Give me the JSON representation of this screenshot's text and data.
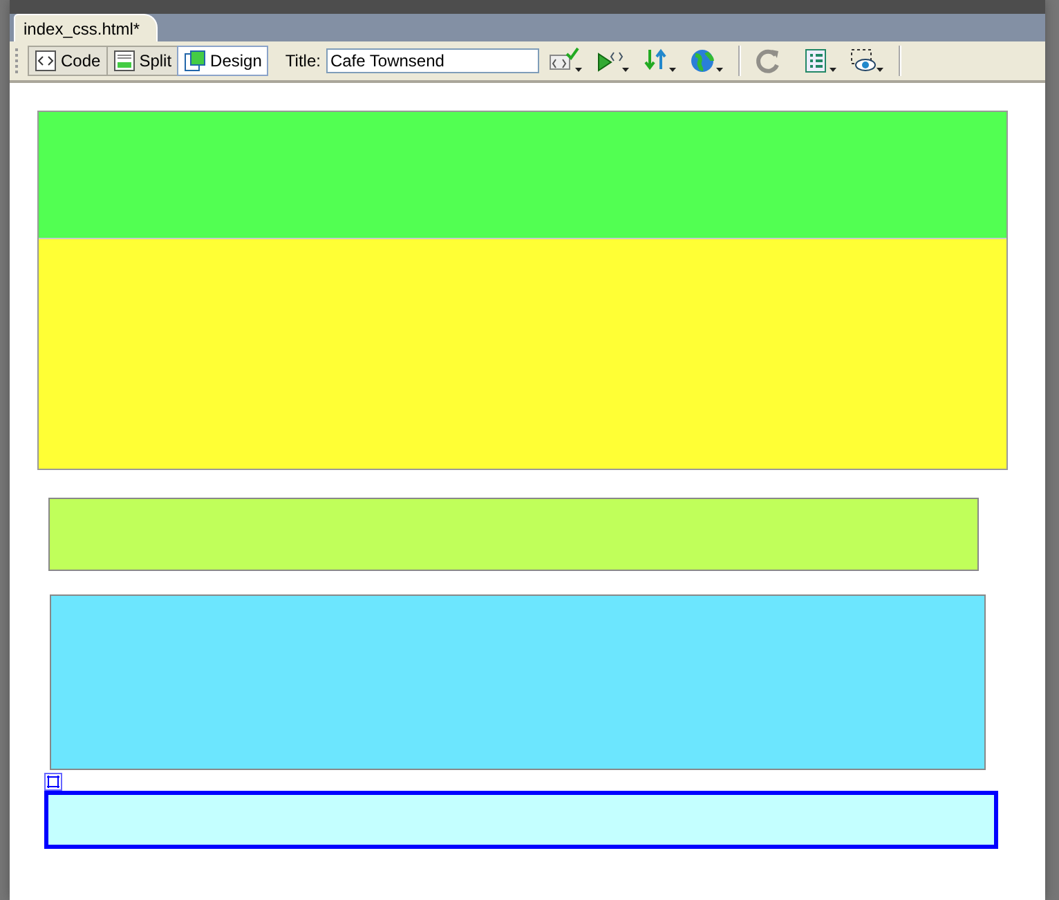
{
  "document_tab": {
    "label": "index_css.html*",
    "selected": true
  },
  "view_buttons": [
    {
      "kind": "code",
      "label": "Code",
      "selected": false
    },
    {
      "kind": "split",
      "label": "Split",
      "selected": false
    },
    {
      "kind": "design",
      "label": "Design",
      "selected": true
    }
  ],
  "title_field": {
    "label": "Title:",
    "value": "Cafe Townsend"
  },
  "toolbar_icons": [
    {
      "kind": "validate",
      "disabled": false
    },
    {
      "kind": "preview",
      "disabled": false
    },
    {
      "kind": "transfer",
      "disabled": false
    },
    {
      "kind": "globe",
      "disabled": false
    },
    {
      "kind": "refresh",
      "disabled": true
    },
    {
      "kind": "options",
      "disabled": false
    },
    {
      "kind": "visual-aids",
      "disabled": false
    }
  ],
  "blocks": [
    {
      "kind": "stack",
      "sections": [
        {
          "color": "#52ff52"
        },
        {
          "color": "#ffff35"
        }
      ]
    },
    {
      "kind": "box",
      "color": "#c0ff5a",
      "selected": false
    },
    {
      "kind": "box",
      "color": "#6ce6fe",
      "selected": false
    },
    {
      "kind": "box",
      "color": "#c4ffff",
      "selected": true
    }
  ]
}
